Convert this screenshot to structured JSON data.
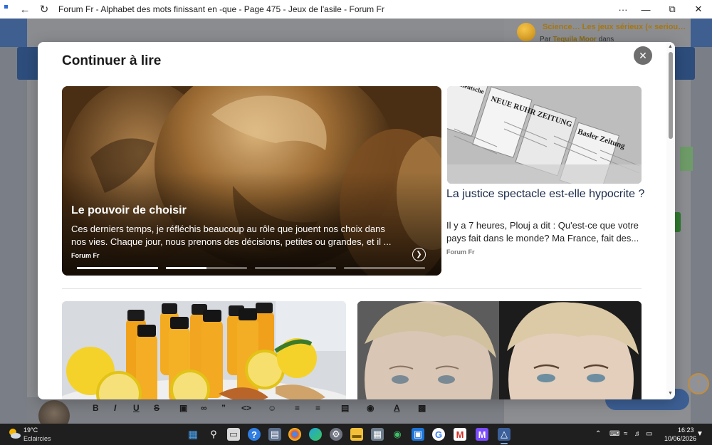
{
  "browser": {
    "title": "Forum Fr - Alphabet des mots finissant en -que - Page 475 - Jeux de l'asile - Forum Fr",
    "more_label": "···"
  },
  "background": {
    "sidebar_topic_title": "Science… Les jeux sérieux (« seriou…",
    "sidebar_topic_by_prefix": "Par",
    "sidebar_topic_author": "Tequila Moor",
    "sidebar_topic_suffix": "dans"
  },
  "modal": {
    "title": "Continuer à lire",
    "featured": {
      "title": "Le pouvoir de choisir",
      "excerpt": "Ces derniers temps, je réfléchis beaucoup au rôle que jouent nos choix dans nos vies. Chaque jour, nous prenons des décisions, petites ou grandes, et il ...",
      "source": "Forum Fr",
      "progress": [
        1.0,
        0.5,
        0.0,
        0.0
      ]
    },
    "side_article": {
      "title": "La justice spectacle est-elle hypocrite ?",
      "excerpt": "Il y a 7 heures, Plouj a dit : Qu'est-ce que votre pays fait dans le monde? Ma France, fait des...",
      "source": "Forum Fr",
      "image_text": {
        "paper1": "Basler Zeitung",
        "paper2": "NEUE RUHR ZEITUNG",
        "paper3": "Westdeutsche"
      }
    }
  },
  "taskbar": {
    "temperature": "19°C",
    "condition": "Eclaircies",
    "time": "16:23",
    "date": "10/06/2026"
  },
  "colors": {
    "modal_bg": "#ffffff",
    "close_button": "#6e6e6e",
    "side_title": "#1a2a4a",
    "taskbar": "#1f1f1f"
  }
}
